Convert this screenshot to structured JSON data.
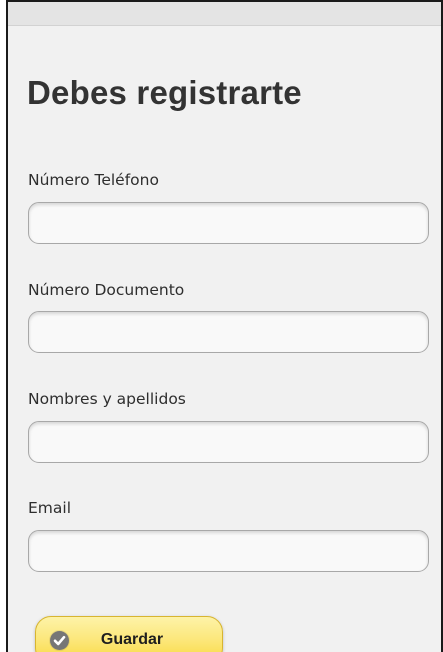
{
  "form": {
    "title": "Debes registrarte",
    "fields": [
      {
        "label": "Número Teléfono",
        "value": "",
        "placeholder": ""
      },
      {
        "label": "Número Documento",
        "value": "",
        "placeholder": ""
      },
      {
        "label": "Nombres y apellidos",
        "value": "",
        "placeholder": ""
      },
      {
        "label": "Email",
        "value": "",
        "placeholder": ""
      }
    ],
    "save_button": {
      "label": "Guardar",
      "icon": "check-circle-icon"
    }
  },
  "colors": {
    "page_background": "#f1f1f1",
    "button_yellow": "#fce77a",
    "icon_gray": "#767676"
  }
}
